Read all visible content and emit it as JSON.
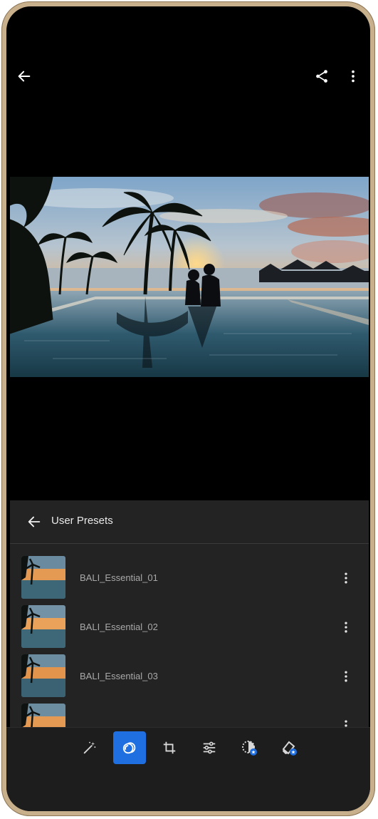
{
  "topbar": {
    "back_icon": "arrow-left-icon",
    "share_icon": "share-icon",
    "more_icon": "more-vertical-icon"
  },
  "photo": {
    "subject": "sunset-infinity-pool-palm-trees"
  },
  "presets_panel": {
    "title": "User Presets",
    "back_icon": "arrow-left-icon",
    "items": [
      {
        "name": "BALI_Essential_01",
        "more_icon": "more-vertical-icon"
      },
      {
        "name": "BALI_Essential_02",
        "more_icon": "more-vertical-icon"
      },
      {
        "name": "BALI_Essential_03",
        "more_icon": "more-vertical-icon"
      },
      {
        "name": "",
        "more_icon": "more-vertical-icon"
      }
    ]
  },
  "toolbar": {
    "tools": [
      {
        "icon": "magic-wand-icon",
        "active": false
      },
      {
        "icon": "presets-icon",
        "active": true
      },
      {
        "icon": "crop-icon",
        "active": false
      },
      {
        "icon": "adjust-sliders-icon",
        "active": false
      },
      {
        "icon": "masking-premium-icon",
        "active": false
      },
      {
        "icon": "healing-premium-icon",
        "active": false
      }
    ],
    "accent_color": "#1f6fe0"
  }
}
